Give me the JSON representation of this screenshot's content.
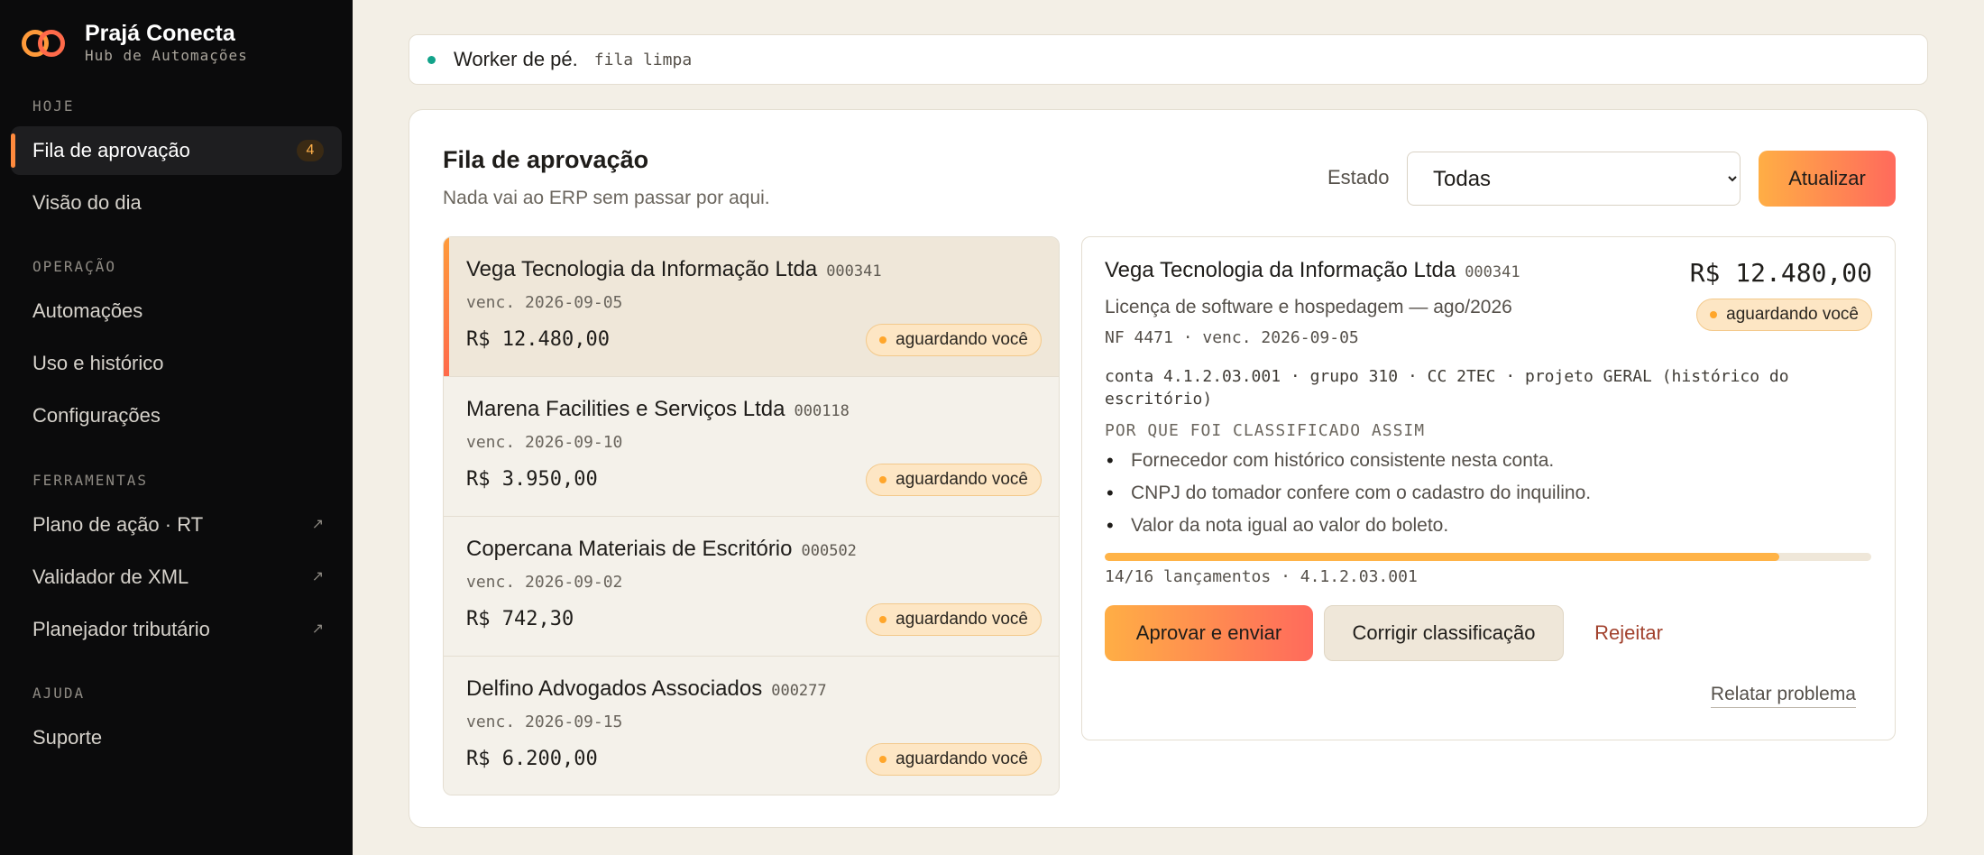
{
  "brand": {
    "name": "Prajá Conecta",
    "subtitle": "Hub de Automações"
  },
  "sidebar": {
    "sections": [
      {
        "label": "HOJE"
      },
      {
        "label": "OPERAÇÃO"
      },
      {
        "label": "FERRAMENTAS"
      },
      {
        "label": "AJUDA"
      }
    ],
    "items": [
      {
        "label": "Fila de aprovação",
        "badge": "4",
        "active": true
      },
      {
        "label": "Visão do dia"
      },
      {
        "label": "Automações"
      },
      {
        "label": "Uso e histórico"
      },
      {
        "label": "Configurações"
      },
      {
        "label": "Plano de ação · RT",
        "external_icon": "↗"
      },
      {
        "label": "Validador de XML",
        "external_icon": "↗"
      },
      {
        "label": "Planejador tributário",
        "external_icon": "↗"
      },
      {
        "label": "Suporte"
      }
    ]
  },
  "status": {
    "title": "Worker de pé.",
    "detail": "fila limpa"
  },
  "queue": {
    "title": "Fila de aprovação",
    "subtitle": "Nada vai ao ERP sem passar por aqui.",
    "filter_label": "Estado",
    "filter_value": "Todas",
    "refresh_label": "Atualizar",
    "items": [
      {
        "name": "Vega Tecnologia da Informação Ltda",
        "code": "000341",
        "due": "venc. 2026-09-05",
        "amount": "R$ 12.480,00",
        "status": "aguardando você"
      },
      {
        "name": "Marena Facilities e Serviços Ltda",
        "code": "000118",
        "due": "venc. 2026-09-10",
        "amount": "R$ 3.950,00",
        "status": "aguardando você"
      },
      {
        "name": "Copercana Materiais de Escritório",
        "code": "000502",
        "due": "venc. 2026-09-02",
        "amount": "R$ 742,30",
        "status": "aguardando você"
      },
      {
        "name": "Delfino Advogados Associados",
        "code": "000277",
        "due": "venc. 2026-09-15",
        "amount": "R$ 6.200,00",
        "status": "aguardando você"
      }
    ]
  },
  "detail": {
    "name": "Vega Tecnologia da Informação Ltda",
    "code": "000341",
    "amount": "R$ 12.480,00",
    "status": "aguardando você",
    "description": "Licença de software e hospedagem — ago/2026",
    "meta": "NF 4471 · venc. 2026-09-05",
    "account": "conta 4.1.2.03.001 · grupo 310 · CC 2TEC · projeto GERAL (histórico do escritório)",
    "why_title": "POR QUE FOI CLASSIFICADO ASSIM",
    "reasons": [
      "Fornecedor com histórico consistente nesta conta.",
      "CNPJ do tomador confere com o cadastro do inquilino.",
      "Valor da nota igual ao valor do boleto."
    ],
    "progress_fraction": 0.88,
    "progress_label": "14/16 lançamentos · 4.1.2.03.001",
    "approve_label": "Aprovar e enviar",
    "fix_label": "Corrigir classificação",
    "reject_label": "Rejeitar",
    "report_label": "Relatar problema"
  },
  "colors": {
    "accent_start": "#ffae45",
    "accent_end": "#ff6a5c",
    "status_ok": "#12a38a",
    "badge_dot": "#ffa62b",
    "reject": "#a2422e"
  }
}
